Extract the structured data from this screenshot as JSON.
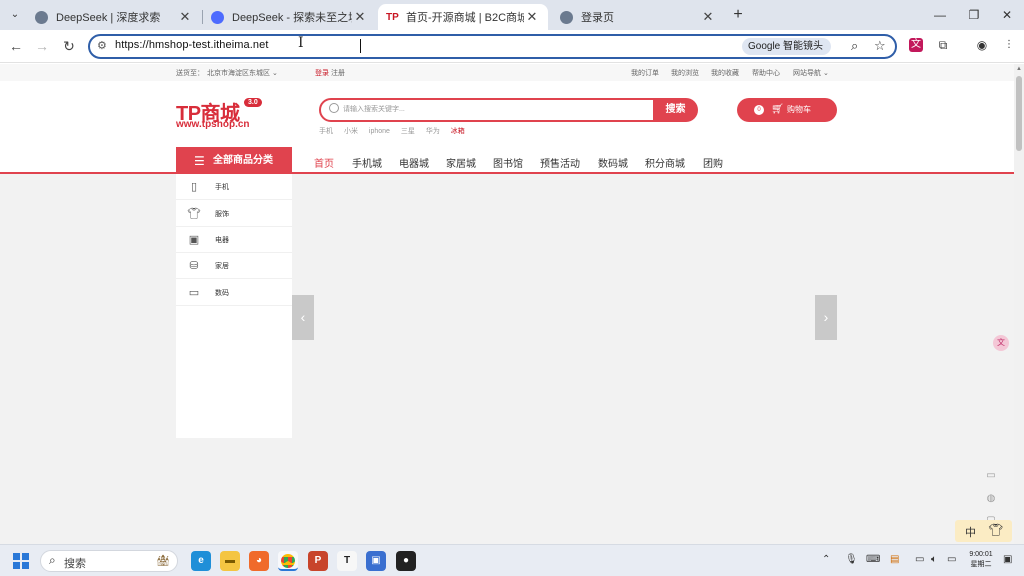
{
  "browser": {
    "tabs": [
      {
        "title": "DeepSeek | 深度求索",
        "close": "✕"
      },
      {
        "title": "DeepSeek - 探索未至之境",
        "close": "✕"
      },
      {
        "title": "首页-开源商城 | B2C商城 | B2B2C",
        "favicon_text": "TP",
        "close": "✕"
      },
      {
        "title": "登录页",
        "close": "✕"
      }
    ],
    "new_tab": "+",
    "window": {
      "minimize": "—",
      "maximize": "❐",
      "close": "✕"
    },
    "url": "https://hmshop-test.itheima.net",
    "lens_label": "Google 智能镜头"
  },
  "page": {
    "shortcut": {
      "location_label": "送货至：",
      "location_value": "北京市海淀区东城区",
      "login": "登录",
      "register": "注册",
      "links": [
        "我的订单",
        "我的浏览",
        "我的收藏",
        "帮助中心",
        "网站导航"
      ]
    },
    "logo": {
      "text": "TP商城",
      "version": "3.0",
      "url": "www.tpshop.cn"
    },
    "search": {
      "placeholder": "请输入搜索关键字...",
      "button": "搜索",
      "hot_words": [
        "手机",
        "小米",
        "iphone",
        "三星",
        "华为",
        "冰箱"
      ]
    },
    "cart": {
      "count": "0",
      "label": "购物车"
    },
    "all_categories": "全部商品分类",
    "nav": [
      "首页",
      "手机城",
      "电器城",
      "家居城",
      "图书馆",
      "预售活动",
      "数码城",
      "积分商城",
      "团购"
    ],
    "categories": [
      {
        "label": "手机",
        "icon": "phone-icon"
      },
      {
        "label": "服饰",
        "icon": "shirt-icon"
      },
      {
        "label": "电器",
        "icon": "appliance-icon"
      },
      {
        "label": "家居",
        "icon": "sofa-icon"
      },
      {
        "label": "数码",
        "icon": "monitor-icon"
      }
    ]
  },
  "ime": {
    "mode": "中",
    "icon": "shirt"
  },
  "taskbar": {
    "search_placeholder": "搜索",
    "time": "9:00:01",
    "date": "星期二"
  },
  "colors": {
    "brand_red": "#e0434e",
    "accent_blue": "#2a78d7"
  }
}
